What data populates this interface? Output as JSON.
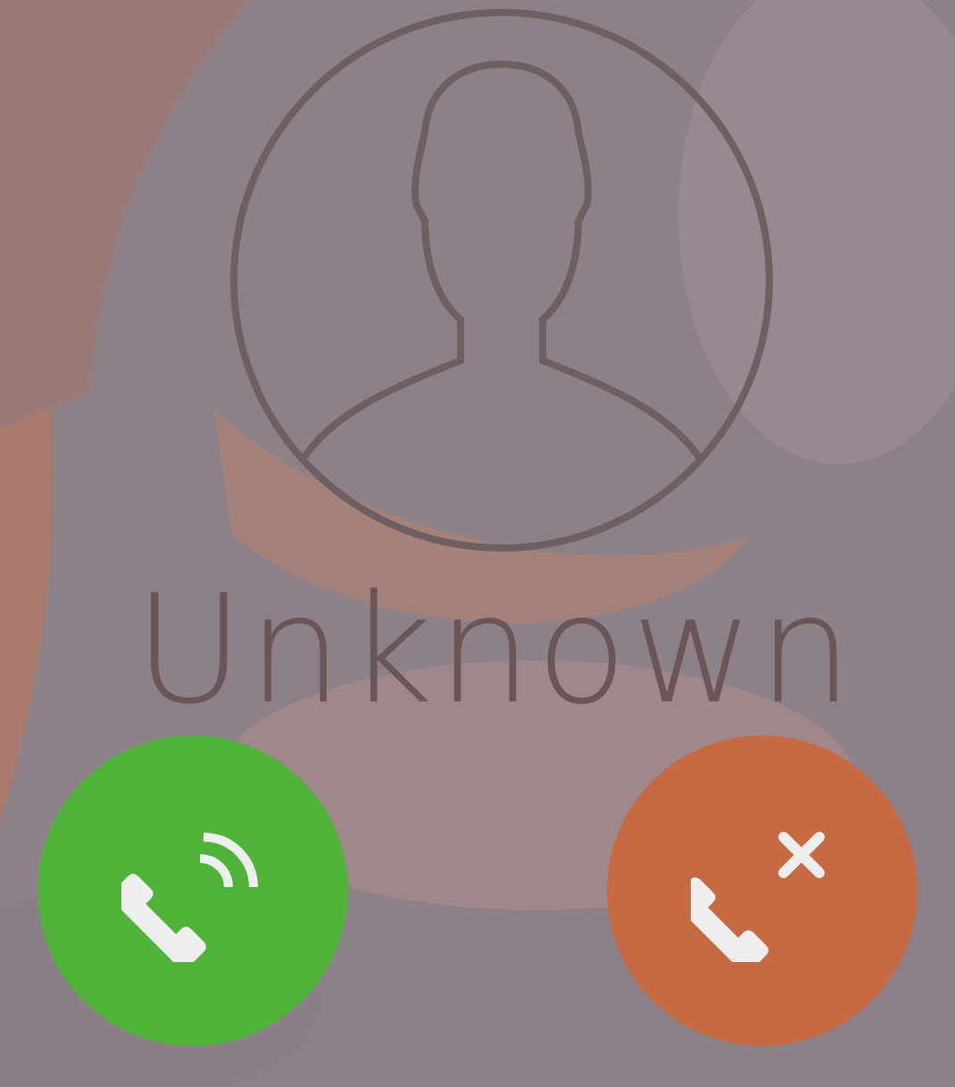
{
  "caller": {
    "name": "Unknown"
  },
  "actions": [
    {
      "kind": "answer",
      "color": "#4fb33a"
    },
    {
      "kind": "decline",
      "color": "#c66a44"
    }
  ]
}
